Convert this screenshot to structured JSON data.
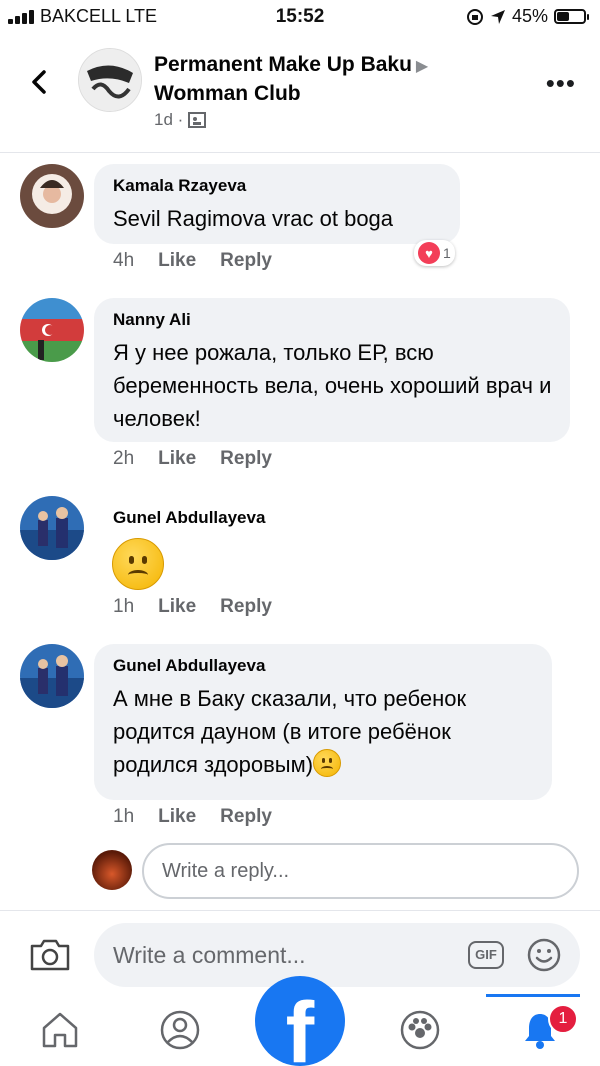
{
  "status_bar": {
    "carrier": "BAKCELL  LTE",
    "time": "15:52",
    "battery": "45%",
    "battery_level": 0.45
  },
  "header": {
    "title_line1": "Permanent Make Up Baku",
    "title_line2": "Womman Club",
    "meta_time": "1d ·",
    "more_label": "•••"
  },
  "comments": [
    {
      "author": "Kamala Rzayeva",
      "text": "Sevil Ragimova vrac ot boga",
      "time": "4h",
      "like": "Like",
      "reply": "Reply",
      "reaction_count": "1"
    },
    {
      "author": "Nanny Ali",
      "text": "Я у нее рожала, только ЕР, всю беременность вела, очень хороший врач и человек!",
      "time": "2h",
      "like": "Like",
      "reply": "Reply"
    },
    {
      "author": "Gunel Abdullayeva",
      "text": "",
      "time": "1h",
      "like": "Like",
      "reply": "Reply"
    },
    {
      "author": "Gunel Abdullayeva",
      "text": "А мне в Баку сказали, что ребенок родится дауном (в итоге ребёнок родился здоровым)",
      "time": "1h",
      "like": "Like",
      "reply": "Reply"
    }
  ],
  "reply_box": {
    "placeholder": "Write a reply..."
  },
  "comment_bar": {
    "placeholder": "Write a comment...",
    "gif_label": "GIF"
  },
  "tabbar": {
    "notifications_badge": "1",
    "fb_logo": "f"
  }
}
